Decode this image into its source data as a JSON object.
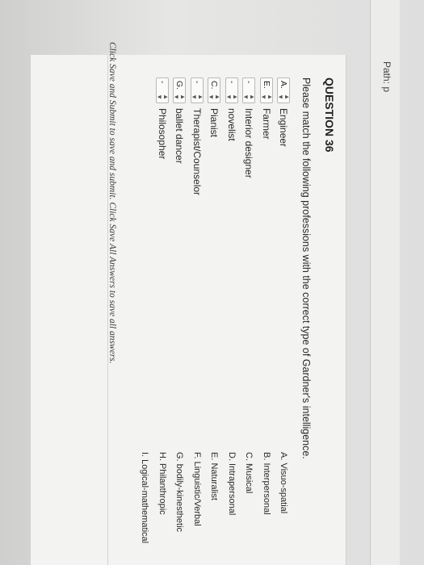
{
  "path_label": "Path: p",
  "question": {
    "title": "QUESTION 36",
    "prompt": "Please match the following professions with the correct type of Gardner's intelligence."
  },
  "matches": [
    {
      "selected": "A.",
      "label": "Engineer"
    },
    {
      "selected": "E.",
      "label": "Farmer"
    },
    {
      "selected": "-",
      "label": "Interior designer"
    },
    {
      "selected": "-",
      "label": "novelist"
    },
    {
      "selected": "C.",
      "label": "Pianist"
    },
    {
      "selected": "-",
      "label": "Therapist/Counselor"
    },
    {
      "selected": "G.",
      "label": "ballet dancer"
    },
    {
      "selected": "-",
      "label": "Philosopher"
    }
  ],
  "choices": [
    "A. Visuo-spatial",
    "B. Interpersonal",
    "C. Musical",
    "D. Intrapersonal",
    "E. Naturalist",
    "F. Linguistic/Verbal",
    "G. bodily-kinesthetic",
    "H. Philanthropic",
    "I. Logical-mathematical"
  ],
  "footer": {
    "text": "Click Save and Submit to save and submit. Click Save All Answers to save all answers."
  }
}
